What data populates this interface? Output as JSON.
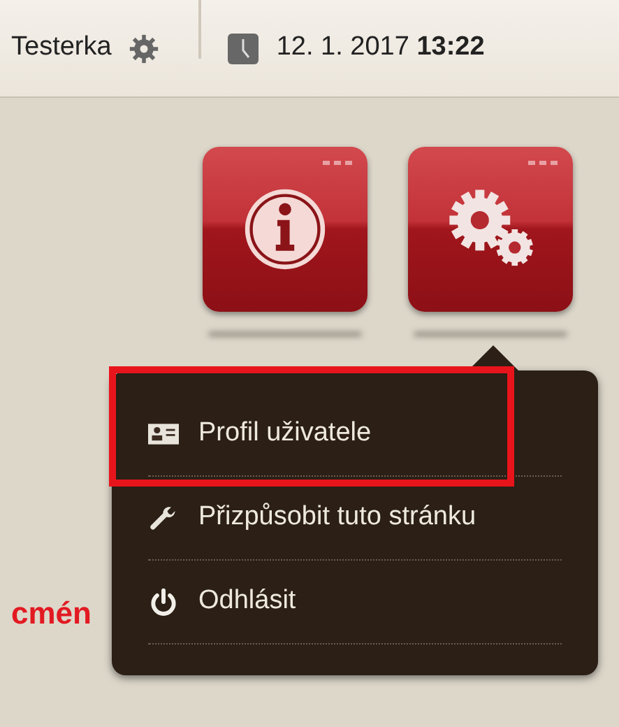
{
  "top_bar": {
    "user_name": "Testerka",
    "datetime": "12. 1. 2017 **13:22**"
  },
  "tiles": [
    {
      "kind": "info"
    },
    {
      "kind": "settings"
    }
  ],
  "background_text": "cmén",
  "menu": {
    "items": [
      {
        "kind": "profile",
        "label": "Profil uživatele",
        "highlighted": true
      },
      {
        "kind": "customize",
        "label": "Přizpůsobit tuto stránku",
        "highlighted": false
      },
      {
        "kind": "logout",
        "label": "Odhlásit",
        "highlighted": false
      }
    ]
  }
}
